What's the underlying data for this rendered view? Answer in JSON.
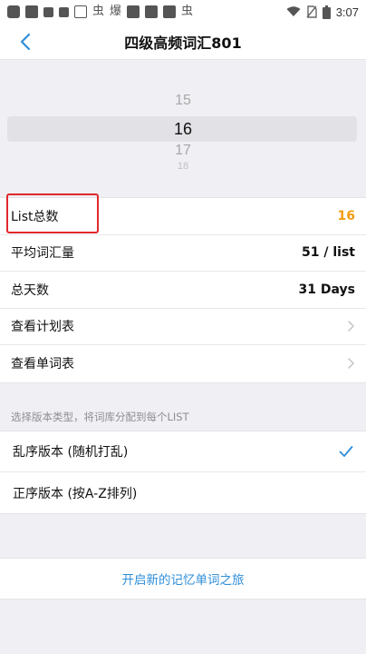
{
  "status_bar": {
    "time": "3:07",
    "left_icons": [
      "notification-icon",
      "s-app-icon",
      "square-icon",
      "square-icon",
      "app-icon",
      "chong-icon",
      "flame-icon",
      "square-icon",
      "square-icon",
      "square-icon",
      "chong-icon"
    ],
    "right_icons": [
      "wifi-icon",
      "no-sim-icon",
      "battery-icon"
    ]
  },
  "nav": {
    "title": "四级高频词汇801",
    "back_icon": "chevron-left-icon"
  },
  "picker": {
    "items": [
      "15",
      "16",
      "17",
      "18"
    ],
    "selected": "16"
  },
  "settings": {
    "list_total_label": "List总数",
    "list_total_value": "16",
    "avg_words_label": "平均词汇量",
    "avg_words_value": "51 / list",
    "total_days_label": "总天数",
    "total_days_value": "31 Days",
    "view_plan_label": "查看计划表",
    "view_words_label": "查看单词表"
  },
  "version": {
    "header": "选择版本类型，将词库分配到每个LIST",
    "options": [
      {
        "label": "乱序版本 (随机打乱)",
        "selected": true
      },
      {
        "label": "正序版本 (按A-Z排列)",
        "selected": false
      }
    ]
  },
  "action": {
    "start_label": "开启新的记忆单词之旅"
  },
  "colors": {
    "accent_orange": "#f39c12",
    "accent_blue": "#2f8ed8",
    "highlight_red": "#e0282d"
  }
}
